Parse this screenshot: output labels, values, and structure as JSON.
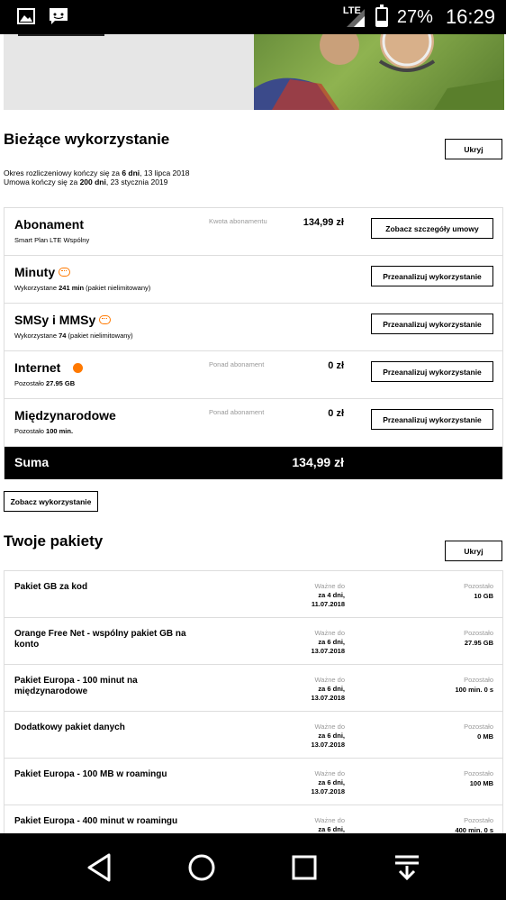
{
  "status_bar": {
    "network": "LTE",
    "battery": "27%",
    "battery_level": 0.27,
    "time": "16:29",
    "icons": [
      "image-icon",
      "message-icon"
    ]
  },
  "current_usage": {
    "title": "Bieżące wykorzystanie",
    "hide_label": "Ukryj",
    "period_prefix": "Okres rozliczeniowy kończy się za ",
    "period_days": "6 dni",
    "period_date": ", 13 lipca 2018",
    "contract_prefix": "Umowa kończy się za ",
    "contract_days": "200 dni",
    "contract_date": ", 23 stycznia 2019",
    "rows": [
      {
        "name": "Abonament",
        "sub_text": "Smart Plan LTE Wspólny",
        "sub_bold": "",
        "sub_after": "",
        "mid": "Kwota abonamentu",
        "amount": "134,99 zł",
        "button": "Zobacz szczegóły umowy",
        "icon": ""
      },
      {
        "name": "Minuty",
        "sub_text": "Wykorzystane ",
        "sub_bold": "241 min",
        "sub_after": " (pakiet nielimitowany)",
        "mid": "",
        "amount": "",
        "button": "Przeanalizuj wykorzystanie",
        "icon": "unlimited-icon"
      },
      {
        "name": "SMSy i MMSy",
        "sub_text": "Wykorzystane ",
        "sub_bold": "74",
        "sub_after": " (pakiet nielimitowany)",
        "mid": "",
        "amount": "",
        "button": "Przeanalizuj wykorzystanie",
        "icon": "unlimited-icon"
      },
      {
        "name": "Internet",
        "sub_text": "Pozostało ",
        "sub_bold": "27.95 GB",
        "sub_after": "",
        "mid": "Ponad abonament",
        "amount": "0 zł",
        "button": "Przeanalizuj wykorzystanie",
        "icon": "internet-icon"
      },
      {
        "name": "Międzynarodowe",
        "sub_text": "Pozostało ",
        "sub_bold": "100 min.",
        "sub_after": "",
        "mid": "Ponad abonament",
        "amount": "0 zł",
        "button": "Przeanalizuj wykorzystanie",
        "icon": ""
      }
    ],
    "sum_label": "Suma",
    "sum_amount": "134,99 zł",
    "see_usage_label": "Zobacz wykorzystanie"
  },
  "packages": {
    "title": "Twoje pakiety",
    "hide_label": "Ukryj",
    "rows": [
      {
        "name": "Pakiet GB za kod",
        "valid_label": "Ważne do",
        "valid_line1": "za 4 dni,",
        "valid_line2": "11.07.2018",
        "remain_label": "Pozostało",
        "remain": "10 GB"
      },
      {
        "name": "Orange Free Net - wspólny pakiet GB na konto",
        "valid_label": "Ważne do",
        "valid_line1": "za 6 dni,",
        "valid_line2": "13.07.2018",
        "remain_label": "Pozostało",
        "remain": "27.95 GB"
      },
      {
        "name": "Pakiet Europa - 100 minut na międzynarodowe",
        "valid_label": "Ważne do",
        "valid_line1": "za 6 dni,",
        "valid_line2": "13.07.2018",
        "remain_label": "Pozostało",
        "remain": "100 min. 0 s"
      },
      {
        "name": "Dodatkowy pakiet danych",
        "valid_label": "Ważne do",
        "valid_line1": "za 6 dni,",
        "valid_line2": "13.07.2018",
        "remain_label": "Pozostało",
        "remain": "0 MB"
      },
      {
        "name": "Pakiet Europa - 100 MB w roamingu",
        "valid_label": "Ważne do",
        "valid_line1": "za 6 dni,",
        "valid_line2": "13.07.2018",
        "remain_label": "Pozostało",
        "remain": "100 MB"
      },
      {
        "name": "Pakiet Europa - 400 minut w roamingu",
        "valid_label": "Ważne do",
        "valid_line1": "za 6 dni,",
        "valid_line2": "",
        "remain_label": "Pozostało",
        "remain": "400 min. 0 s"
      }
    ]
  },
  "nav_bar": {
    "buttons": [
      "back-icon",
      "home-icon",
      "recents-icon",
      "notifications-icon"
    ]
  }
}
